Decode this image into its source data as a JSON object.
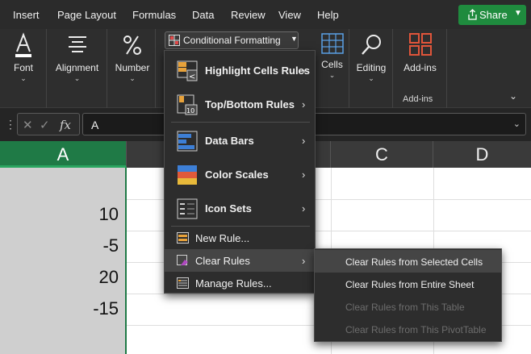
{
  "menubar": {
    "items": [
      "Insert",
      "Page Layout",
      "Formulas",
      "Data",
      "Review",
      "View",
      "Help"
    ],
    "share_label": "Share"
  },
  "ribbon": {
    "font_label": "Font",
    "alignment_label": "Alignment",
    "number_label": "Number",
    "conditional_formatting_label": "Conditional Formatting",
    "cells_label": "Cells",
    "editing_label": "Editing",
    "addins_label": "Add-ins",
    "addins_group_label": "Add-ins"
  },
  "formula_bar": {
    "fx_label": "fx",
    "value": "A"
  },
  "grid": {
    "column_headers": [
      "A",
      "C",
      "D"
    ],
    "column_a_values": [
      "10",
      "-5",
      "20",
      "-15"
    ]
  },
  "cf_menu": {
    "items": [
      {
        "label": "Highlight Cells Rules",
        "has_submenu": true
      },
      {
        "label": "Top/Bottom Rules",
        "has_submenu": true
      },
      {
        "label": "Data Bars",
        "has_submenu": true
      },
      {
        "label": "Color Scales",
        "has_submenu": true
      },
      {
        "label": "Icon Sets",
        "has_submenu": true
      },
      {
        "label": "New Rule...",
        "has_submenu": false
      },
      {
        "label": "Clear Rules",
        "has_submenu": true,
        "highlighted": true
      },
      {
        "label": "Manage Rules...",
        "has_submenu": false
      }
    ]
  },
  "clear_rules_submenu": {
    "items": [
      {
        "label": "Clear Rules from Selected Cells",
        "enabled": true,
        "highlighted": true
      },
      {
        "label": "Clear Rules from Entire Sheet",
        "enabled": true
      },
      {
        "label": "Clear Rules from This Table",
        "enabled": false
      },
      {
        "label": "Clear Rules from This PivotTable",
        "enabled": false
      }
    ]
  },
  "colors": {
    "accent_green": "#1f7a46",
    "share_green": "#1f8b3e",
    "menu_bg": "#2d2d2d",
    "highlight_bg": "#454545"
  }
}
